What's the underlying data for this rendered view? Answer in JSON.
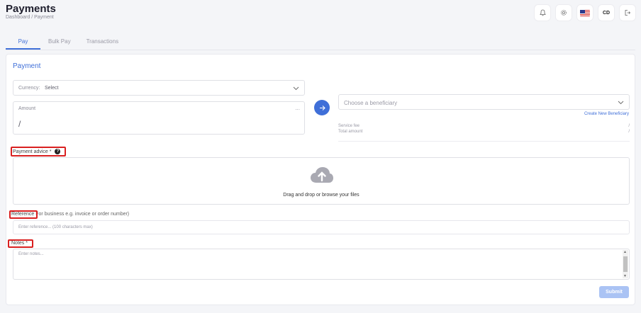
{
  "header": {
    "title": "Payments",
    "breadcrumb": "Dashboard / Payment",
    "avatar_initials": "CD"
  },
  "tabs": [
    {
      "label": "Pay",
      "active": true
    },
    {
      "label": "Bulk Pay",
      "active": false
    },
    {
      "label": "Transactions",
      "active": false
    }
  ],
  "payment": {
    "title": "Payment",
    "currency_label": "Currency:",
    "currency_value": "Select",
    "amount_label": "Amount",
    "amount_value": "/",
    "amount_menu": "...",
    "beneficiary_placeholder": "Choose a beneficiary",
    "create_beneficiary": "Create New Beneficiary",
    "service_fee_label": "Service fee",
    "service_fee_value": "/",
    "total_amount_label": "Total amount",
    "total_amount_value": "/",
    "payment_advice_label": "Payment advice *",
    "help_icon": "?",
    "drop_text": "Drag and drop or browse your files",
    "reference_label": "Reference",
    "reference_hint": "For business e.g. invoice or order number)",
    "reference_placeholder": "Enter reference... (100 characters max)",
    "notes_label": "Notes *",
    "notes_placeholder": "Enter notes...",
    "submit_label": "Submit"
  },
  "colors": {
    "accent": "#3f6fd8",
    "highlight_box": "#d92020",
    "submit_disabled": "#aac3f4"
  },
  "icons": [
    "bell-icon",
    "gear-icon",
    "us-flag-icon",
    "logout-icon",
    "chevron-down-icon",
    "arrow-right-icon",
    "cloud-upload-icon",
    "help-icon"
  ]
}
